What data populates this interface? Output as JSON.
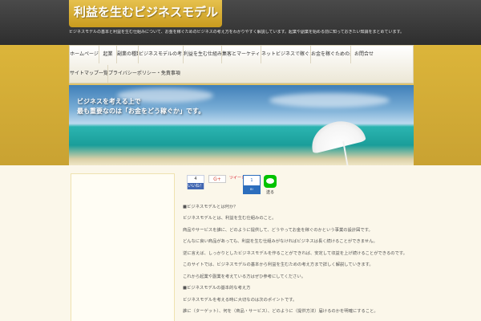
{
  "header": {
    "logo_text": "利益を生むビジネスモデル",
    "tagline": "ビジネスモデルの基本と利益を生む仕組みについて、お金を稼ぐためのビジネスの考え方をわかりやすく解説しています。起業や副業を始める前に知っておきたい知識をまとめています。"
  },
  "nav": {
    "row1": [
      "ホームページ",
      "起業",
      "副業の種類",
      "ビジネスモデルの考え方",
      "利益を生む仕組みとは",
      "集客とマーケティング",
      "ネットビジネスで稼ぐための方法",
      "お金を稼ぐための基本知識",
      "お問合せ"
    ],
    "row2": [
      "サイトマップ一覧",
      "プライバシーポリシー・免責事項について"
    ]
  },
  "hero": {
    "line1": "ビジネスを考える上で",
    "line2": "最も重要なのは「お金をどう稼ぐか」です。"
  },
  "share": {
    "fb_count": "4",
    "fb_label": "いいね！",
    "gplus_label": "G+",
    "tweet_label": "ツイート",
    "hatena_count": "1",
    "hatena_label": "B!",
    "line_label": "送る"
  },
  "content": {
    "lines": [
      "■ビジネスモデルとは何か？",
      "ビジネスモデルとは、利益を生む仕組みのこと。",
      "商品やサービスを誰に、どのように提供して、どうやってお金を稼ぐのかという事業の設計図です。",
      "どんなに良い商品があっても、利益を生む仕組みがなければビジネスは長く続けることができません。",
      "逆に言えば、しっかりとしたビジネスモデルを作ることができれば、安定して収益を上げ続けることができるのです。",
      "このサイトでは、ビジネスモデルの基本から利益を生むための考え方まで詳しく解説していきます。",
      "これから起業や副業を考えている方はぜひ参考にしてください。",
      "■ビジネスモデルの基本的な考え方",
      "ビジネスモデルを考える時に大切なのは次のポイントです。",
      "誰に（ターゲット）、何を（商品・サービス）、どのように（提供方法）届けるのかを明確にすること。"
    ]
  }
}
